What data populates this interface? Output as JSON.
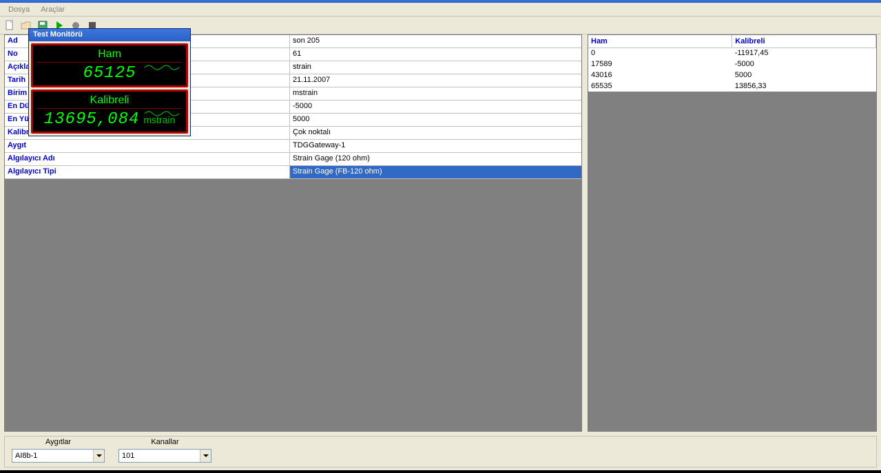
{
  "menubar": {
    "file": "Dosya",
    "tools": "Araçlar"
  },
  "form": {
    "rows": [
      {
        "label": "Ad",
        "value": "son 205"
      },
      {
        "label": "No",
        "value": "61"
      },
      {
        "label": "Açıklama",
        "value": "strain"
      },
      {
        "label": "Tarih",
        "value": "21.11.2007"
      },
      {
        "label": "Birim",
        "value": "mstrain"
      },
      {
        "label": "En Düşük",
        "value": "-5000"
      },
      {
        "label": "En Yüksek",
        "value": "5000"
      },
      {
        "label": "Kalibrasyon",
        "value": "Çok noktalı"
      },
      {
        "label": "Aygıt",
        "value": "TDGGateway-1"
      },
      {
        "label": "Algılayıcı Adı",
        "value": "Strain Gage (120 ohm)"
      },
      {
        "label": "Algılayıcı Tipi",
        "value": "Strain Gage (FB-120 ohm)"
      }
    ],
    "selected_index": 10
  },
  "grid": {
    "headers": {
      "ham": "Ham",
      "kalibreli": "Kalibreli"
    },
    "rows": [
      {
        "ham": "0",
        "kalibreli": "-11917,45"
      },
      {
        "ham": "17589",
        "kalibreli": "-5000"
      },
      {
        "ham": "43016",
        "kalibreli": "5000"
      },
      {
        "ham": "65535",
        "kalibreli": "13856,33"
      }
    ]
  },
  "bottom": {
    "devices_label": "Aygıtlar",
    "channels_label": "Kanallar",
    "device_value": "AI8b-1",
    "channel_value": "101"
  },
  "monitor": {
    "title": "Test Monitörü",
    "ham_label": "Ham",
    "ham_value": "65125",
    "kal_label": "Kalibreli",
    "kal_value": "13695,084",
    "kal_unit": "mstrain"
  }
}
